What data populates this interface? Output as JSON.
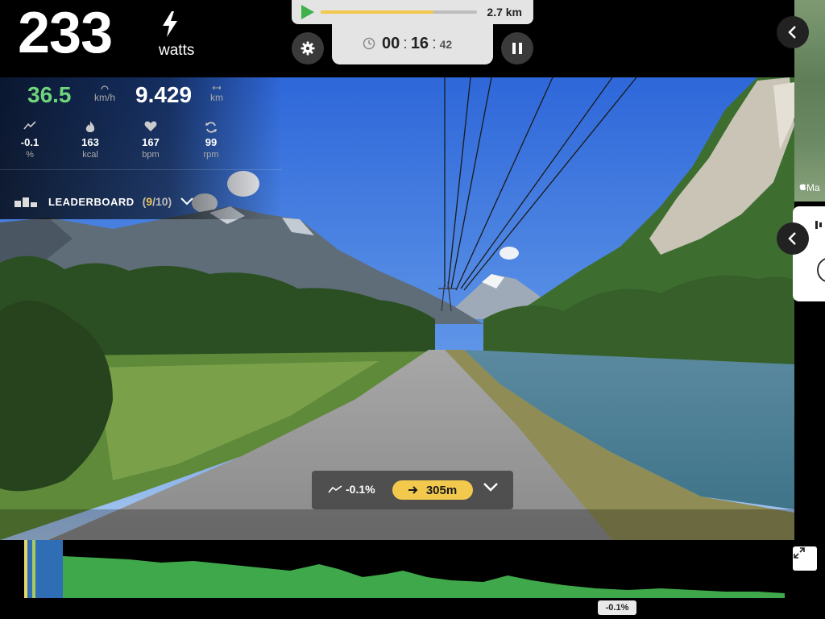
{
  "power": {
    "value": "233",
    "unit": "watts",
    "icon": "bolt-icon"
  },
  "route": {
    "distance_total": "2.7 km",
    "progress_fraction": 0.72
  },
  "timer": {
    "hours_minutes_a": "00",
    "minutes": "16",
    "seconds": "42",
    "separator": ":"
  },
  "stats": {
    "speed": {
      "value": "36.5",
      "unit": "km/h"
    },
    "distance": {
      "value": "9.429",
      "unit": "km"
    },
    "metrics": [
      {
        "icon": "grade-icon",
        "value": "-0.1",
        "label": "%"
      },
      {
        "icon": "flame-icon",
        "value": "163",
        "label": "kcal"
      },
      {
        "icon": "heart-icon",
        "value": "167",
        "label": "bpm"
      },
      {
        "icon": "cadence-icon",
        "value": "99",
        "label": "rpm"
      }
    ]
  },
  "leaderboard": {
    "label": "LEADERBOARD",
    "open": "(",
    "position": "9",
    "total": "/10)"
  },
  "map": {
    "attribution": "Ma"
  },
  "grade_pill": {
    "current_grade": "-0.1%",
    "next_segment": "305m"
  },
  "profile": {
    "grade_tag": "-0.1%"
  },
  "colors": {
    "accent_yellow": "#f2c94c",
    "speed_green": "#6fd47a",
    "profile_green": "#3fa84a",
    "profile_blue": "#2f6db5"
  }
}
